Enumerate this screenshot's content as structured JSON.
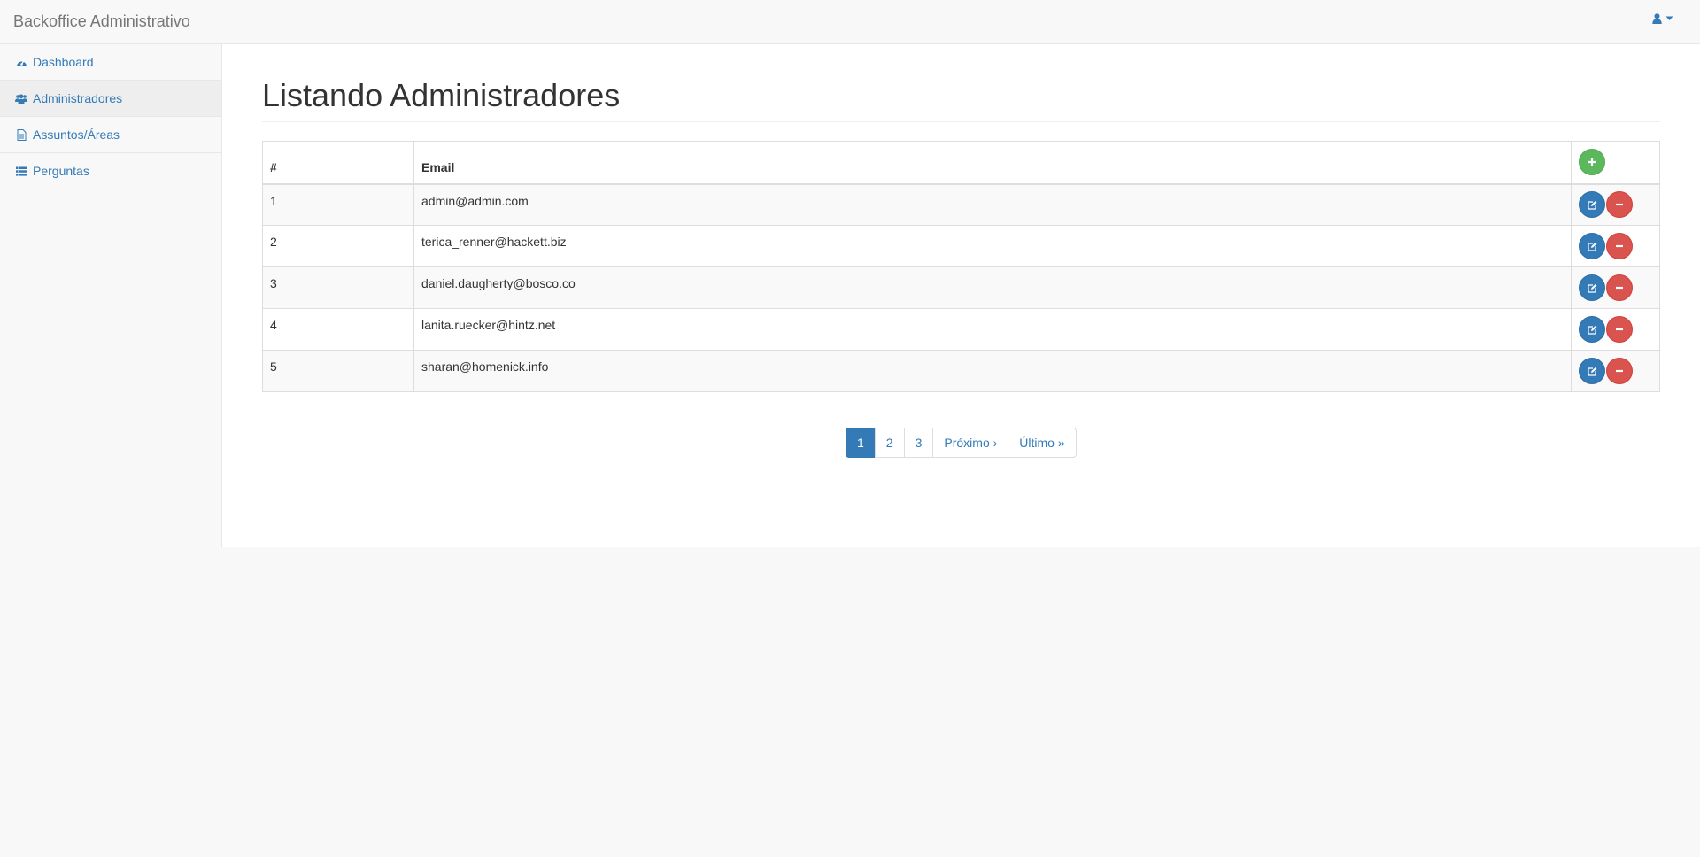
{
  "navbar": {
    "brand": "Backoffice Administrativo",
    "user_icon": "user-icon",
    "caret_icon": "caret-down-icon"
  },
  "sidebar": {
    "items": [
      {
        "label": "Dashboard",
        "icon": "dashboard-icon",
        "active": false
      },
      {
        "label": "Administradores",
        "icon": "users-icon",
        "active": true
      },
      {
        "label": "Assuntos/Áreas",
        "icon": "file-icon",
        "active": false
      },
      {
        "label": "Perguntas",
        "icon": "list-icon",
        "active": false
      }
    ]
  },
  "main": {
    "title": "Listando Administradores",
    "table": {
      "headers": [
        "#",
        "Email"
      ],
      "rows": [
        {
          "id": "1",
          "email": "admin@admin.com"
        },
        {
          "id": "2",
          "email": "terica_renner@hackett.biz"
        },
        {
          "id": "3",
          "email": "daniel.daugherty@bosco.co"
        },
        {
          "id": "4",
          "email": "lanita.ruecker@hintz.net"
        },
        {
          "id": "5",
          "email": "sharan@homenick.info"
        }
      ]
    },
    "pagination": {
      "pages": [
        "1",
        "2",
        "3"
      ],
      "current": "1",
      "next": "Próximo ›",
      "last": "Último »"
    }
  },
  "colors": {
    "link": "#337ab7",
    "success": "#5cb85c",
    "danger": "#d9534f"
  }
}
